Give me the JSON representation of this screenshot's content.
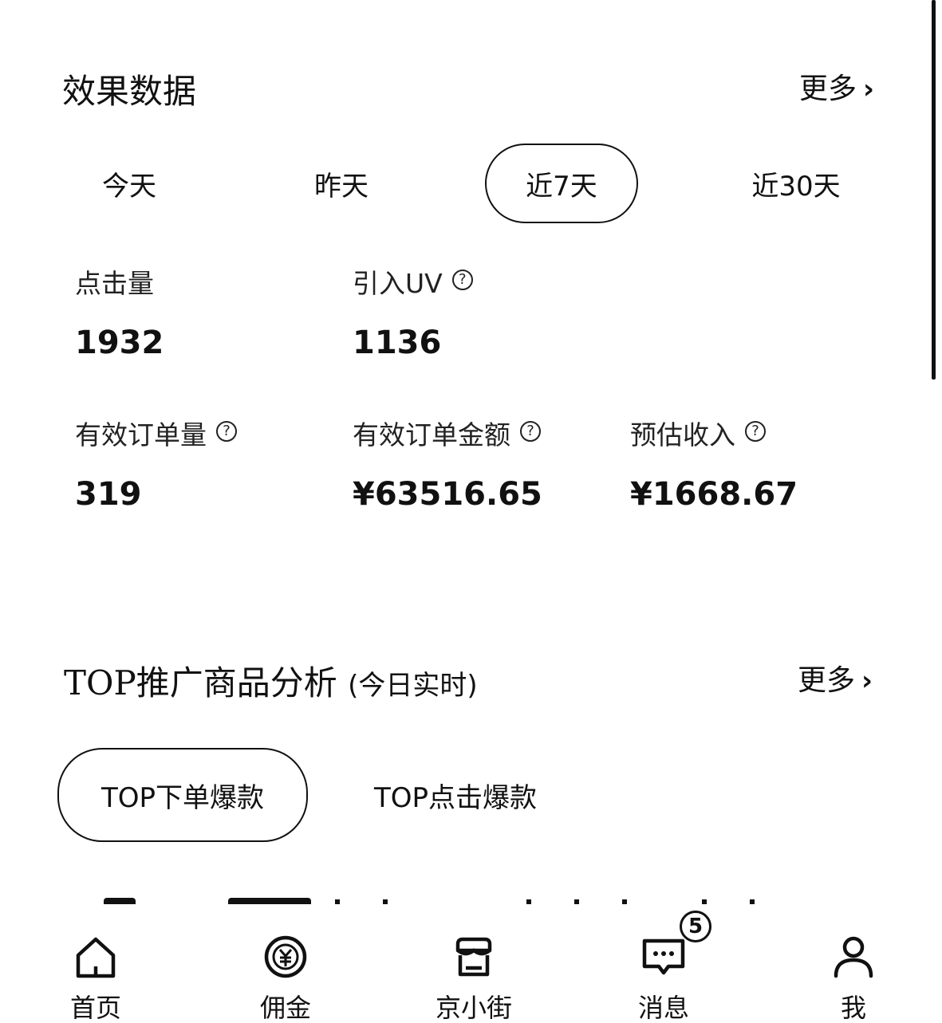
{
  "performance": {
    "title": "效果数据",
    "more_label": "更多",
    "date_tabs": [
      {
        "label": "今天",
        "active": false
      },
      {
        "label": "昨天",
        "active": false
      },
      {
        "label": "近7天",
        "active": true
      },
      {
        "label": "近30天",
        "active": false
      }
    ],
    "metrics": [
      {
        "label": "点击量",
        "value": "1932",
        "help": false
      },
      {
        "label": "引入UV",
        "value": "1136",
        "help": true
      },
      {
        "label": "有效订单量",
        "value": "319",
        "help": true
      },
      {
        "label": "有效订单金额",
        "value": "¥63516.65",
        "help": true
      },
      {
        "label": "预估收入",
        "value": "¥1668.67",
        "help": true
      }
    ]
  },
  "top_products": {
    "title": "TOP推广商品分析",
    "subtitle": "(今日实时)",
    "more_label": "更多",
    "tabs": [
      {
        "label": "TOP下单爆款",
        "active": true
      },
      {
        "label": "TOP点击爆款",
        "active": false
      }
    ]
  },
  "bottom_nav": {
    "items": [
      {
        "label": "首页",
        "icon": "home-icon"
      },
      {
        "label": "佣金",
        "icon": "commission-icon"
      },
      {
        "label": "京小街",
        "icon": "store-icon"
      },
      {
        "label": "消息",
        "icon": "message-icon",
        "badge": "5"
      },
      {
        "label": "我",
        "icon": "profile-icon"
      }
    ]
  },
  "icons": {
    "chevron": "chevron-right-icon",
    "help": "question-circle-icon",
    "help_glyph": "?",
    "chevron_glyph": "›"
  },
  "colors": {
    "text": "#111111",
    "background": "#ffffff"
  }
}
